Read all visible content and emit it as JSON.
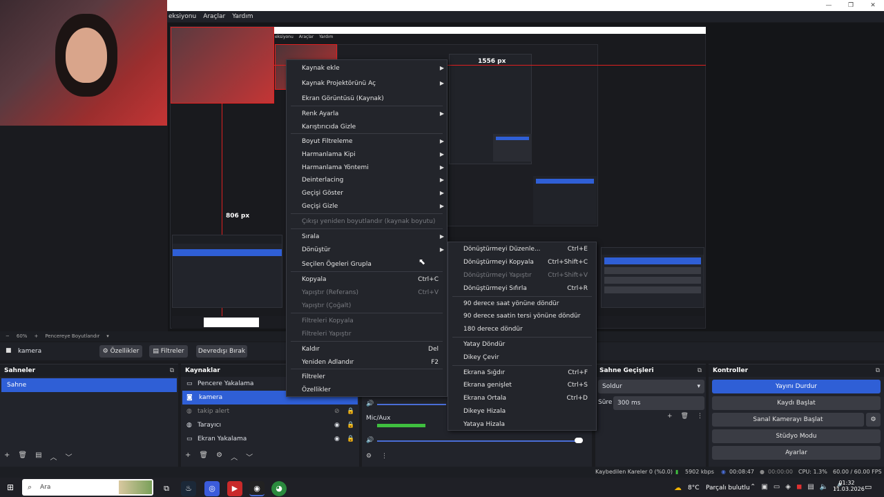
{
  "menubar": {
    "items": [
      "eksiyonu",
      "Araçlar",
      "Yardım"
    ]
  },
  "inner": {
    "menu_items": [
      "eksiyonu",
      "Araçlar",
      "Yardım"
    ],
    "px_h": "1556 px",
    "px_v": "806 px"
  },
  "context_menu": {
    "items": [
      {
        "label": "Kaynak ekle",
        "arrow": true
      },
      {
        "label": "Kaynak Projektörünü Aç",
        "arrow": true
      },
      {
        "label": "Ekran Görüntüsü (Kaynak)"
      },
      {
        "label": "Renk Ayarla",
        "arrow": true
      },
      {
        "label": "Karıştırıcıda Gizle"
      },
      {
        "label": "Boyut Filtreleme",
        "arrow": true
      },
      {
        "label": "Harmanlama Kipi",
        "arrow": true
      },
      {
        "label": "Harmanlama Yöntemi",
        "arrow": true
      },
      {
        "label": "Deinterlacing",
        "arrow": true
      },
      {
        "label": "Geçişi Göster",
        "arrow": true
      },
      {
        "label": "Geçişi Gizle",
        "arrow": true
      },
      {
        "label": "Çıkışı yeniden boyutlandır (kaynak boyutu)",
        "disabled": true
      },
      {
        "label": "Sırala",
        "arrow": true
      },
      {
        "label": "Dönüştür",
        "arrow": true
      },
      {
        "label": "Seçilen Ögeleri Grupla"
      },
      {
        "label": "Kopyala",
        "shortcut": "Ctrl+C"
      },
      {
        "label": "Yapıştır (Referans)",
        "shortcut": "Ctrl+V",
        "disabled": true
      },
      {
        "label": "Yapıştır (Çoğalt)",
        "disabled": true
      },
      {
        "label": "Filtreleri Kopyala",
        "disabled": true
      },
      {
        "label": "Filtreleri Yapıştır",
        "disabled": true
      },
      {
        "label": "Kaldır",
        "shortcut": "Del"
      },
      {
        "label": "Yeniden Adlandır",
        "shortcut": "F2"
      },
      {
        "label": "Filtreler"
      },
      {
        "label": "Özellikler"
      }
    ]
  },
  "submenu": {
    "items": [
      {
        "label": "Dönüştürmeyi Düzenle...",
        "shortcut": "Ctrl+E"
      },
      {
        "label": "Dönüştürmeyi Kopyala",
        "shortcut": "Ctrl+Shift+C"
      },
      {
        "label": "Dönüştürmeyi Yapıştır",
        "shortcut": "Ctrl+Shift+V",
        "disabled": true
      },
      {
        "label": "Dönüştürmeyi Sıfırla",
        "shortcut": "Ctrl+R"
      },
      {
        "label": "90 derece saat yönüne döndür"
      },
      {
        "label": "90 derece saatin tersi yönüne döndür"
      },
      {
        "label": "180 derece döndür"
      },
      {
        "label": "Yatay Döndür"
      },
      {
        "label": "Dikey Çevir"
      },
      {
        "label": "Ekrana Sığdır",
        "shortcut": "Ctrl+F"
      },
      {
        "label": "Ekrana genişlet",
        "shortcut": "Ctrl+S"
      },
      {
        "label": "Ekrana Ortala",
        "shortcut": "Ctrl+D"
      },
      {
        "label": "Dikeye Hizala"
      },
      {
        "label": "Yataya Hizala"
      }
    ]
  },
  "statusrow": {
    "zoom": "60%",
    "fit": "Pencereye Boyutlandır"
  },
  "sourcebar": {
    "source": "kamera",
    "properties": "Özellikler",
    "filters": "Filtreler",
    "deactivate": "Devredışı Bırak"
  },
  "scenes": {
    "title": "Sahneler",
    "items": [
      "Sahne"
    ]
  },
  "sources": {
    "title": "Kaynaklar",
    "items": [
      "Pencere Yakalama",
      "kamera",
      "takip alert",
      "Tarayıcı",
      "Ekran Yakalama"
    ]
  },
  "mixer": {
    "mic": "Mic/Aux"
  },
  "transitions": {
    "title": "Sahne Geçişleri",
    "type": "Soldur",
    "duration_label": "Süre",
    "duration": "300 ms"
  },
  "controls": {
    "title": "Kontroller",
    "buttons": [
      "Yayını Durdur",
      "Kaydı Başlat",
      "Sanal Kamerayı Başlat",
      "Stüdyo Modu",
      "Ayarlar"
    ]
  },
  "statusbar": {
    "dropped": "Kaybedilen Kareler 0 (%0.0)",
    "bitrate": "5902 kbps",
    "live": "00:08:47",
    "rec": "00:00:00",
    "cpu": "CPU: 1.3%",
    "fps": "60.00 / 60.00 FPS"
  },
  "taskbar": {
    "search": "Ara",
    "weather_temp": "8°C",
    "weather_text": "Parçalı bulutlu",
    "time": "01:32",
    "date": "11.03.2026"
  },
  "colors": {
    "accent": "#2f5fd6",
    "red": "#e02020"
  }
}
